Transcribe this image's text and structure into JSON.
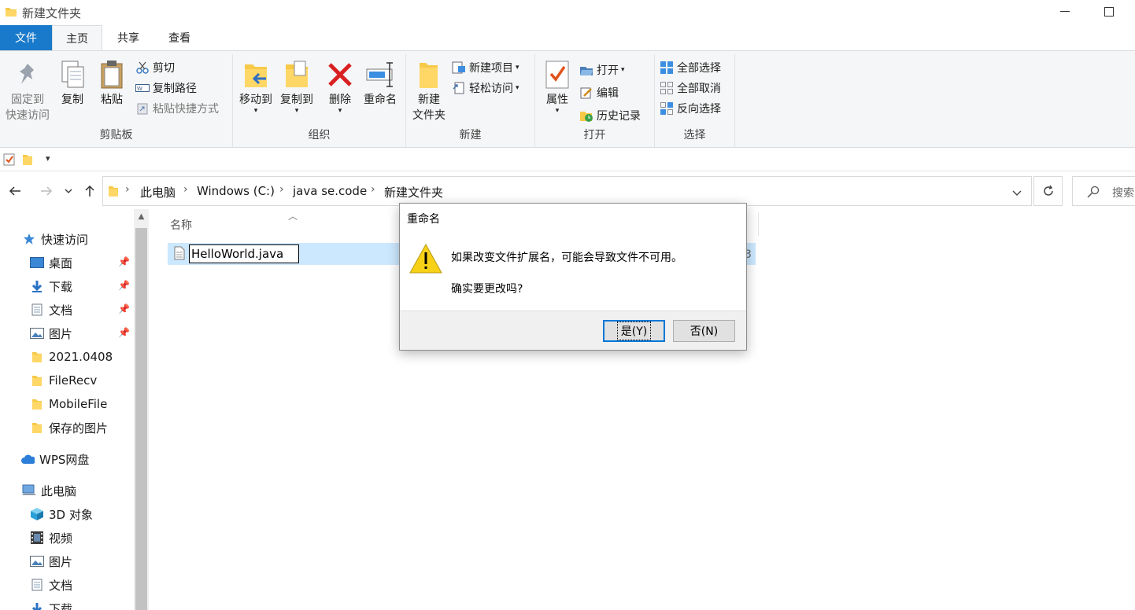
{
  "window": {
    "title": "新建文件夹"
  },
  "ribbon_tabs": [
    "文件",
    "主页",
    "共享",
    "查看"
  ],
  "clipboard": {
    "pin_line1": "固定到",
    "pin_line2": "快速访问",
    "copy": "复制",
    "paste": "粘贴",
    "cut": "剪切",
    "copy_path": "复制路径",
    "paste_shortcut": "粘贴快捷方式",
    "group_label": "剪贴板"
  },
  "organize": {
    "move_to": "移动到",
    "copy_to": "复制到",
    "delete": "删除",
    "rename": "重命名",
    "group_label": "组织"
  },
  "new_group": {
    "new_folder_line1": "新建",
    "new_folder_line2": "文件夹",
    "new_item": "新建项目",
    "easy_access": "轻松访问",
    "group_label": "新建"
  },
  "open_group": {
    "properties": "属性",
    "open": "打开",
    "edit": "编辑",
    "history": "历史记录",
    "group_label": "打开"
  },
  "select_group": {
    "select_all": "全部选择",
    "select_none": "全部取消",
    "invert": "反向选择",
    "group_label": "选择"
  },
  "address": {
    "crumbs": [
      "此电脑",
      "Windows (C:)",
      "java se.code",
      "新建文件夹"
    ],
    "search_placeholder": "搜索"
  },
  "sidebar": {
    "quick_access": "快速访问",
    "pinned": [
      "桌面",
      "下载",
      "文档",
      "图片"
    ],
    "folders": [
      "2021.0408",
      "FileRecv",
      "MobileFile",
      "保存的图片"
    ],
    "wps": "WPS网盘",
    "this_pc": "此电脑",
    "pc_items": [
      "3D 对象",
      "视频",
      "图片",
      "文档",
      "下载"
    ]
  },
  "content": {
    "column_name": "名称",
    "rename_value": "HelloWorld.java",
    "size_fragment": "3"
  },
  "dialog": {
    "title": "重命名",
    "message1": "如果改变文件扩展名，可能会导致文件不可用。",
    "message2": "确实要更改吗?",
    "yes_label": "是(Y)",
    "no_label": "否(N)"
  },
  "colors": {
    "accent": "#1979ca",
    "selection": "#cce8ff",
    "folder": "#f7c948"
  }
}
